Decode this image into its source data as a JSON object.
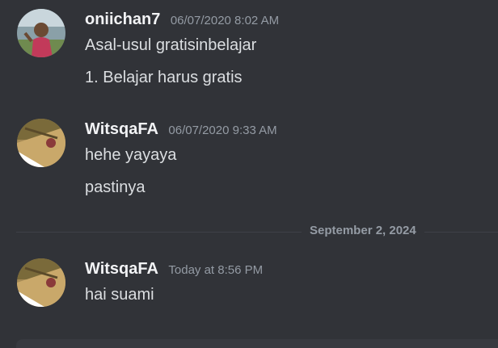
{
  "messages": [
    {
      "username": "oniichan7",
      "timestamp": "06/07/2020 8:02 AM",
      "lines": [
        "Asal-usul gratisinbelajar",
        "1. Belajar harus gratis"
      ],
      "avatar": "person-photo-avatar"
    },
    {
      "username": "WitsqaFA",
      "timestamp": "06/07/2020 9:33 AM",
      "lines": [
        "hehe yayaya",
        "pastinya"
      ],
      "avatar": "landscape-photo-avatar"
    },
    {
      "username": "WitsqaFA",
      "timestamp": "Today at 8:56 PM",
      "lines": [
        "hai suami"
      ],
      "avatar": "landscape-photo-avatar"
    }
  ],
  "divider": {
    "label": "September 2, 2024"
  },
  "colors": {
    "background": "#313338",
    "username": "#f2f3f5",
    "timestamp": "#949ba4",
    "text": "#dbdee1"
  }
}
